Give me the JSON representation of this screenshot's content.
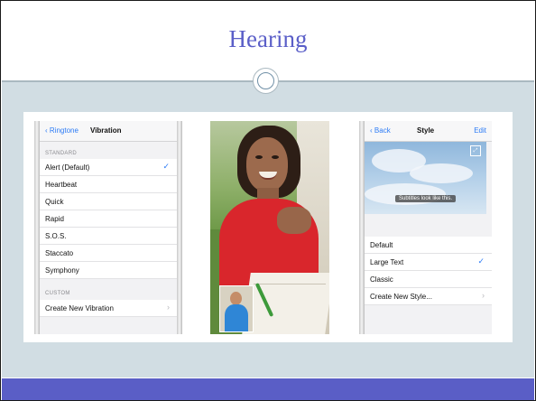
{
  "slide": {
    "title": "Hearing"
  },
  "vibration_panel": {
    "back": "Ringtone",
    "title": "Vibration",
    "standard_header": "STANDARD",
    "standard_items": [
      {
        "label": "Alert (Default)",
        "checked": true
      },
      {
        "label": "Heartbeat",
        "checked": false
      },
      {
        "label": "Quick",
        "checked": false
      },
      {
        "label": "Rapid",
        "checked": false
      },
      {
        "label": "S.O.S.",
        "checked": false
      },
      {
        "label": "Staccato",
        "checked": false
      },
      {
        "label": "Symphony",
        "checked": false
      }
    ],
    "custom_header": "CUSTOM",
    "custom_item": "Create New Vibration"
  },
  "style_panel": {
    "back": "Back",
    "title": "Style",
    "edit": "Edit",
    "subtitle_preview": "Subtitles look like this.",
    "items": [
      {
        "label": "Default",
        "checked": false
      },
      {
        "label": "Large Text",
        "checked": true
      },
      {
        "label": "Classic",
        "checked": false
      },
      {
        "label": "Create New Style...",
        "chevron": true
      }
    ]
  },
  "icons": {
    "check": "✓",
    "chevron": "›",
    "back_chevron": "‹",
    "expand": "⤢"
  },
  "colors": {
    "title": "#5b5fc8",
    "accent_bar": "#5a5ec6",
    "content_bg": "#d1dde3",
    "ios_blue": "#2d7cf6"
  }
}
